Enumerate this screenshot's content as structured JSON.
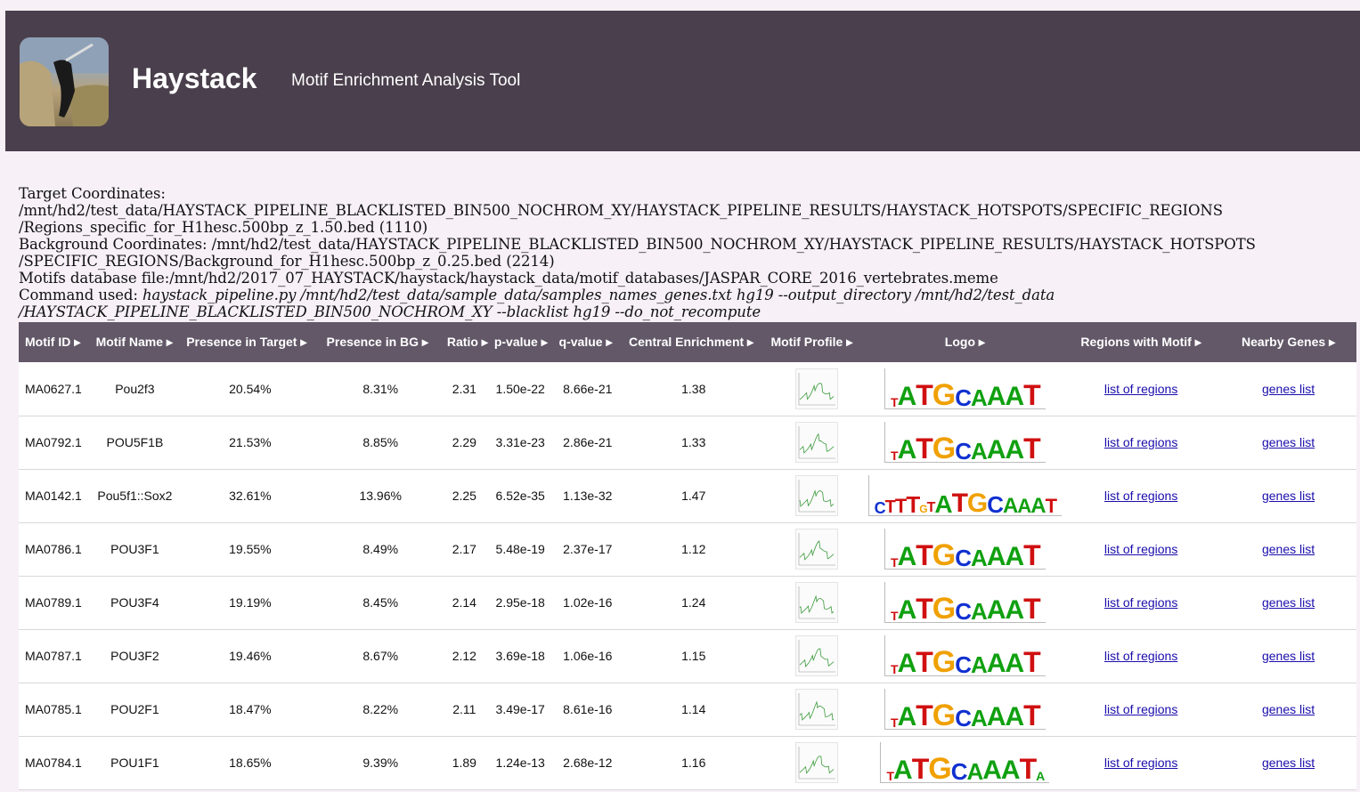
{
  "header": {
    "title": "Haystack",
    "subtitle": "Motif Enrichment Analysis Tool",
    "logo_icon": "haystack-photo-logo"
  },
  "info": {
    "target_label": "Target Coordinates: ",
    "target_value": "/mnt/hd2/test_data/HAYSTACK_PIPELINE_BLACKLISTED_BIN500_NOCHROM_XY/HAYSTACK_PIPELINE_RESULTS/HAYSTACK_HOTSPOTS/SPECIFIC_REGIONS\n/Regions_specific_for_H1hesc.500bp_z_1.50.bed (1110)",
    "background_label": "Background Coordinates: ",
    "background_value": "/mnt/hd2/test_data/HAYSTACK_PIPELINE_BLACKLISTED_BIN500_NOCHROM_XY/HAYSTACK_PIPELINE_RESULTS/HAYSTACK_HOTSPOTS\n/SPECIFIC_REGIONS/Background_for_H1hesc.500bp_z_0.25.bed (2214)",
    "motifs_label": "Motifs database file:",
    "motifs_value": "/mnt/hd2/2017_07_HAYSTACK/haystack/haystack_data/motif_databases/JASPAR_CORE_2016_vertebrates.meme",
    "command_label": "Command used: ",
    "command_value": "haystack_pipeline.py /mnt/hd2/test_data/sample_data/samples_names_genes.txt hg19 --output_directory /mnt/hd2/test_data\n/HAYSTACK_PIPELINE_BLACKLISTED_BIN500_NOCHROM_XY --blacklist hg19 --do_not_recompute"
  },
  "table": {
    "columns": [
      "Motif ID ▸",
      "Motif Name ▸",
      "Presence in Target ▸",
      "Presence in BG ▸",
      "Ratio ▸",
      "p-value ▸",
      "q-value ▸",
      "Central Enrichment ▸",
      "Motif Profile ▸",
      "Logo ▸",
      "Regions with Motif ▸",
      "Nearby Genes ▸"
    ],
    "link_regions": "list of regions",
    "link_genes": "genes list",
    "rows": [
      {
        "id": "MA0627.1",
        "name": "Pou2f3",
        "target": "20.54%",
        "bg": "8.31%",
        "ratio": "2.31",
        "p": "1.50e-22",
        "q": "8.66e-21",
        "ce": "1.38",
        "logo": "TATGCAAAT"
      },
      {
        "id": "MA0792.1",
        "name": "POU5F1B",
        "target": "21.53%",
        "bg": "8.85%",
        "ratio": "2.29",
        "p": "3.31e-23",
        "q": "2.86e-21",
        "ce": "1.33",
        "logo": "TATGCAAAT"
      },
      {
        "id": "MA0142.1",
        "name": "Pou5f1::Sox2",
        "target": "32.61%",
        "bg": "13.96%",
        "ratio": "2.25",
        "p": "6.52e-35",
        "q": "1.13e-32",
        "ce": "1.47",
        "logo": "CTTTGTATGCAAAT"
      },
      {
        "id": "MA0786.1",
        "name": "POU3F1",
        "target": "19.55%",
        "bg": "8.49%",
        "ratio": "2.17",
        "p": "5.48e-19",
        "q": "2.37e-17",
        "ce": "1.12",
        "logo": "TATGCAAAT"
      },
      {
        "id": "MA0789.1",
        "name": "POU3F4",
        "target": "19.19%",
        "bg": "8.45%",
        "ratio": "2.14",
        "p": "2.95e-18",
        "q": "1.02e-16",
        "ce": "1.24",
        "logo": "TATGCAAAT"
      },
      {
        "id": "MA0787.1",
        "name": "POU3F2",
        "target": "19.46%",
        "bg": "8.67%",
        "ratio": "2.12",
        "p": "3.69e-18",
        "q": "1.06e-16",
        "ce": "1.15",
        "logo": "TATGCAAAT"
      },
      {
        "id": "MA0785.1",
        "name": "POU2F1",
        "target": "18.47%",
        "bg": "8.22%",
        "ratio": "2.11",
        "p": "3.49e-17",
        "q": "8.61e-16",
        "ce": "1.14",
        "logo": "TATGCAAAT"
      },
      {
        "id": "MA0784.1",
        "name": "POU1F1",
        "target": "18.65%",
        "bg": "9.39%",
        "ratio": "1.89",
        "p": "1.24e-13",
        "q": "2.68e-12",
        "ce": "1.16",
        "logo": "TATGCAAATA"
      }
    ]
  }
}
